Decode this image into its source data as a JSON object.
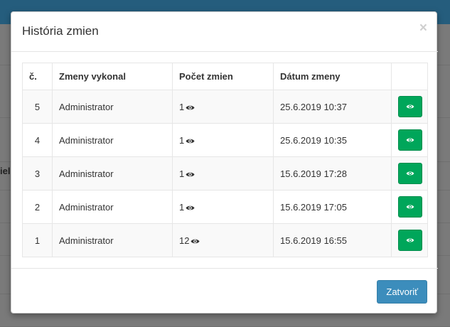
{
  "background": {
    "partial_text": "iel"
  },
  "modal": {
    "title": "História zmien",
    "close_symbol": "×",
    "table": {
      "headers": [
        "č.",
        "Zmeny vykonal",
        "Počet zmien",
        "Dátum zmeny",
        ""
      ],
      "rows": [
        {
          "no": "5",
          "user": "Administrator",
          "count": "1",
          "date": "25.6.2019 10:37"
        },
        {
          "no": "4",
          "user": "Administrator",
          "count": "1",
          "date": "25.6.2019 10:35"
        },
        {
          "no": "3",
          "user": "Administrator",
          "count": "1",
          "date": "15.6.2019 17:28"
        },
        {
          "no": "2",
          "user": "Administrator",
          "count": "1",
          "date": "15.6.2019 17:05"
        },
        {
          "no": "1",
          "user": "Administrator",
          "count": "12",
          "date": "15.6.2019 16:55"
        }
      ]
    },
    "footer": {
      "close_label": "Zatvoriť"
    }
  },
  "icons": {
    "count_icon": "eye-icon",
    "view_button_icon": "eye-icon"
  },
  "colors": {
    "top_bar": "#255d7d",
    "view_button": "#00a65a",
    "close_button": "#3c8dbc"
  }
}
